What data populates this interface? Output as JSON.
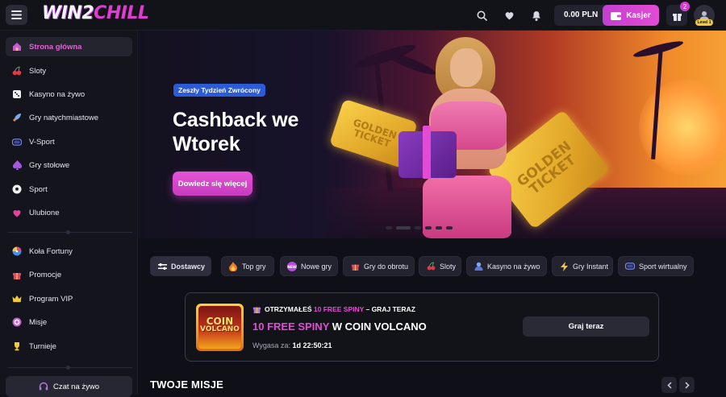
{
  "header": {
    "logo_part1": "WIN2",
    "logo_part2": "CHILL",
    "balance": "0.00 PLN",
    "cashier_label": "Kasjer",
    "gift_count": "2",
    "level_label": "Level 1"
  },
  "sidebar": {
    "items": [
      {
        "label": "Strona główna",
        "icon": "home-icon"
      },
      {
        "label": "Sloty",
        "icon": "cherry-icon"
      },
      {
        "label": "Kasyno na żywo",
        "icon": "dice-icon"
      },
      {
        "label": "Gry natychmiastowe",
        "icon": "rocket-icon"
      },
      {
        "label": "V-Sport",
        "icon": "vr-icon"
      },
      {
        "label": "Gry stołowe",
        "icon": "spade-icon"
      },
      {
        "label": "Sport",
        "icon": "football-icon"
      },
      {
        "label": "Ulubione",
        "icon": "heart-icon"
      },
      {
        "label": "Koła Fortuny",
        "icon": "wheel-icon"
      },
      {
        "label": "Promocje",
        "icon": "gift-icon"
      },
      {
        "label": "Program VIP",
        "icon": "crown-icon"
      },
      {
        "label": "Misje",
        "icon": "target-icon"
      },
      {
        "label": "Turnieje",
        "icon": "trophy-icon"
      }
    ],
    "chat_label": "Czat na żywo"
  },
  "hero": {
    "tag": "Zeszły Tydzień Zwrócony",
    "title": "Cashback we Wtorek",
    "cta": "Dowiedz się więcej",
    "ticket_text": "GOLDEN TICKET"
  },
  "categories": [
    {
      "label": "Dostawcy",
      "icon": "sliders-icon"
    },
    {
      "label": "Top gry",
      "icon": "fire-icon"
    },
    {
      "label": "Nowe gry",
      "icon": "new-badge-icon"
    },
    {
      "label": "Gry do obrotu",
      "icon": "gift-icon"
    },
    {
      "label": "Sloty",
      "icon": "cherry-icon"
    },
    {
      "label": "Kasyno na żywo",
      "icon": "dealer-icon"
    },
    {
      "label": "Gry Instant",
      "icon": "lightning-icon"
    },
    {
      "label": "Sport wirtualny",
      "icon": "vr-icon"
    }
  ],
  "promo": {
    "thumb_line1": "COIN",
    "thumb_line2": "VOLCANO",
    "head_prefix": "OTRZYMAŁEŚ ",
    "head_highlight": "10 FREE SPINY",
    "head_suffix": " – GRAJ TERAZ",
    "title_highlight": "10 FREE SPINY",
    "title_rest": " W COIN VOLCANO",
    "expires_label": "Wygasa za: ",
    "expires_value": "1d 22:50:21",
    "button": "Graj teraz"
  },
  "missions": {
    "title": "TWOJE MISJE"
  },
  "colors": {
    "accent": "#e34bd4",
    "tag_blue": "#2c5bd8"
  }
}
